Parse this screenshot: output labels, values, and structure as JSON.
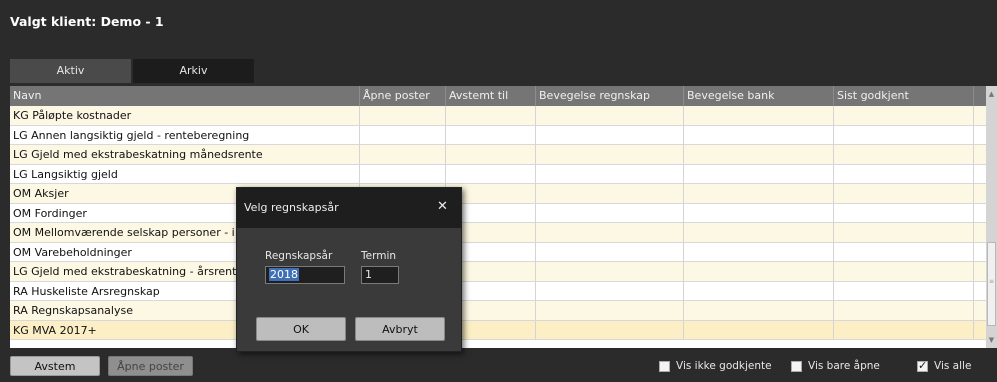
{
  "header": {
    "title": "Valgt klient: Demo - 1"
  },
  "tabs": [
    {
      "label": "Aktiv",
      "active": true
    },
    {
      "label": "Arkiv",
      "active": false
    }
  ],
  "grid": {
    "columns": [
      "Navn",
      "Åpne poster",
      "Avstemt til",
      "Bevegelse regnskap",
      "Bevegelse bank",
      "Sist godkjent"
    ],
    "rows": [
      [
        "KG Påløpte kostnader",
        "",
        "",
        "",
        "",
        ""
      ],
      [
        "LG Annen langsiktig gjeld - renteberegning",
        "",
        "",
        "",
        "",
        ""
      ],
      [
        "LG Gjeld med ekstrabeskatning månedsrente",
        "",
        "",
        "",
        "",
        ""
      ],
      [
        "LG Langsiktig gjeld",
        "",
        "",
        "",
        "",
        ""
      ],
      [
        "OM Aksjer",
        "",
        "",
        "",
        "",
        ""
      ],
      [
        "OM Fordinger",
        "",
        "",
        "",
        "",
        ""
      ],
      [
        "OM Mellomværende selskap personer - i",
        "",
        "",
        "",
        "",
        ""
      ],
      [
        "OM Varebeholdninger",
        "",
        "",
        "",
        "",
        ""
      ],
      [
        "LG Gjeld med ekstrabeskatning - årsrent",
        "",
        "",
        "",
        "",
        ""
      ],
      [
        "RA Huskeliste Arsregnskap",
        "",
        "",
        "",
        "",
        ""
      ],
      [
        "RA Regnskapsanalyse",
        "",
        "",
        "",
        "",
        ""
      ],
      [
        "KG MVA 2017+",
        "",
        "",
        "",
        "",
        ""
      ]
    ]
  },
  "toolbar": {
    "avstem_label": "Avstem",
    "apne_poster_label": "Åpne poster",
    "vis_ikke_godkjente": {
      "label": "Vis ikke godkjente",
      "checked": false
    },
    "vis_bare_apne": {
      "label": "Vis bare åpne",
      "checked": false
    },
    "vis_alle": {
      "label": "Vis alle",
      "checked": true
    }
  },
  "dialog": {
    "title": "Velg regnskapsår",
    "close_icon": "close-icon",
    "year_label": "Regnskapsår",
    "year_value": "2018",
    "termin_label": "Termin",
    "termin_value": "1",
    "ok_label": "OK",
    "cancel_label": "Avbryt"
  }
}
